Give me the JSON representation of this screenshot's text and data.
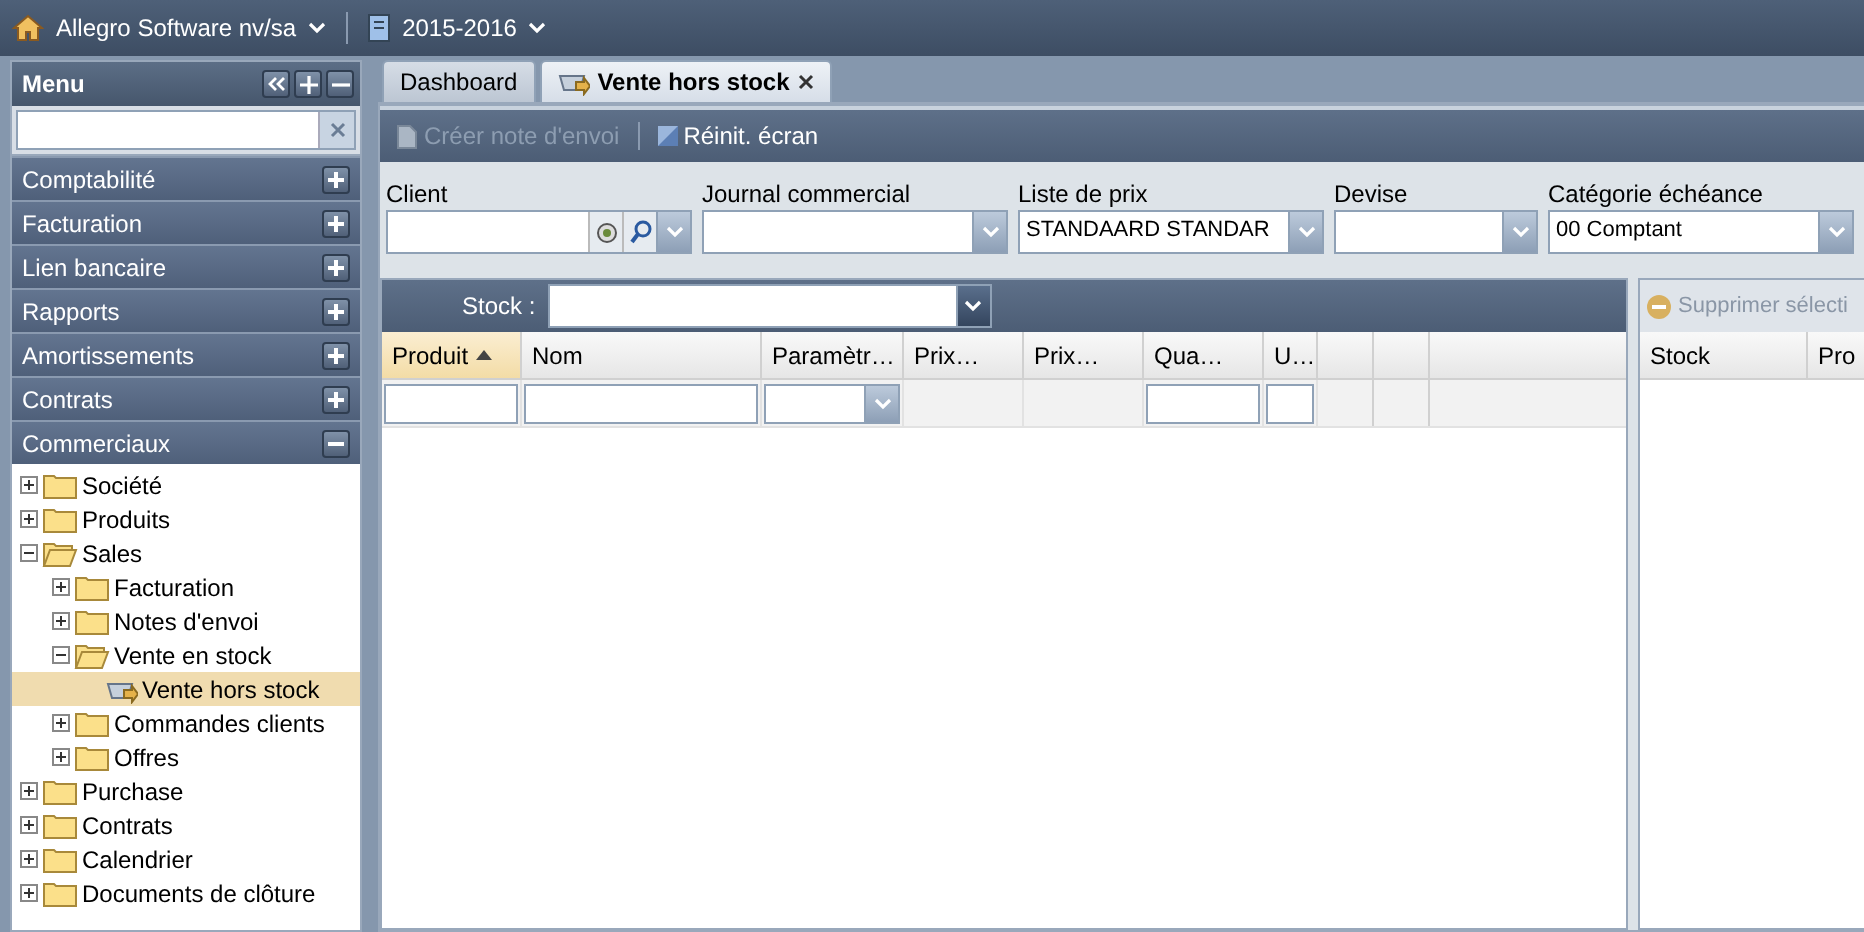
{
  "top_bar": {
    "company": "Allegro Software nv/sa",
    "year": "2015-2016"
  },
  "menu": {
    "title": "Menu",
    "sections": [
      {
        "label": "Comptabilité",
        "expanded": false
      },
      {
        "label": "Facturation",
        "expanded": false
      },
      {
        "label": "Lien bancaire",
        "expanded": false
      },
      {
        "label": "Rapports",
        "expanded": false
      },
      {
        "label": "Amortissements",
        "expanded": false
      },
      {
        "label": "Contrats",
        "expanded": false
      },
      {
        "label": "Commerciaux",
        "expanded": true
      }
    ],
    "tree": [
      {
        "label": "Société",
        "kind": "folder",
        "expanded": false,
        "selected": false
      },
      {
        "label": "Produits",
        "kind": "folder",
        "expanded": false,
        "selected": false
      },
      {
        "label": "Sales",
        "kind": "folder",
        "expanded": true,
        "selected": false,
        "children": [
          {
            "label": "Facturation",
            "kind": "folder",
            "expanded": false,
            "selected": false
          },
          {
            "label": "Notes d'envoi",
            "kind": "folder",
            "expanded": false,
            "selected": false
          },
          {
            "label": "Vente en stock",
            "kind": "folder",
            "expanded": true,
            "selected": false,
            "children": [
              {
                "label": "Vente hors stock",
                "kind": "page",
                "expanded": false,
                "selected": true
              }
            ]
          },
          {
            "label": "Commandes clients",
            "kind": "folder",
            "expanded": false,
            "selected": false
          },
          {
            "label": "Offres",
            "kind": "folder",
            "expanded": false,
            "selected": false
          }
        ]
      },
      {
        "label": "Purchase",
        "kind": "folder",
        "expanded": false,
        "selected": false
      },
      {
        "label": "Contrats",
        "kind": "folder",
        "expanded": false,
        "selected": false
      },
      {
        "label": "Calendrier",
        "kind": "folder",
        "expanded": false,
        "selected": false
      },
      {
        "label": "Documents de clôture",
        "kind": "folder",
        "expanded": false,
        "selected": false
      }
    ]
  },
  "tabs": [
    {
      "label": "Dashboard",
      "selected": false,
      "closable": false
    },
    {
      "label": "Vente hors stock",
      "selected": true,
      "closable": true
    }
  ],
  "toolbar": [
    {
      "label": "Créer note d'envoi",
      "disabled": true
    },
    {
      "label": "Réinit. écran",
      "disabled": false
    }
  ],
  "fields": [
    {
      "label": "Client",
      "kind": "lookup"
    },
    {
      "label": "Journal commercial",
      "kind": "combo"
    },
    {
      "label": "Liste de prix",
      "kind": "combo",
      "value": "STANDAARD STANDAR"
    },
    {
      "label": "Devise",
      "kind": "combo"
    },
    {
      "label": "Catégorie échéance",
      "kind": "combo",
      "value": "00 Comptant"
    }
  ],
  "grid": {
    "stock_label": "Stock :",
    "columns": [
      {
        "label": "Produit",
        "sorted": true,
        "kind": "text"
      },
      {
        "label": "Nom",
        "sorted": false,
        "kind": "text"
      },
      {
        "label": "Paramètr…",
        "sorted": false,
        "kind": "combo"
      },
      {
        "label": "Prix…",
        "sorted": false,
        "kind": "none"
      },
      {
        "label": "Prix…",
        "sorted": false,
        "kind": "none"
      },
      {
        "label": "Qua…",
        "sorted": false,
        "kind": "text"
      },
      {
        "label": "U…",
        "sorted": false,
        "kind": "text"
      }
    ]
  },
  "side_grid": {
    "action": "Supprimer sélecti",
    "columns": [
      "Stock",
      "Pro"
    ]
  }
}
